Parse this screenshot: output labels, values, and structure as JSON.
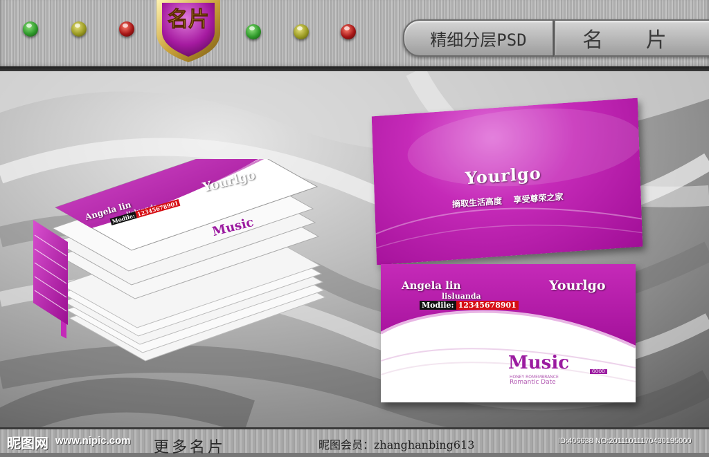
{
  "header": {
    "badge_text": "名片",
    "plaque_left": "精细分层PSD",
    "plaque_right": "名 片",
    "indicator_lights": [
      {
        "name": "green-light",
        "color": "#2e9a2a"
      },
      {
        "name": "yellow-light",
        "color": "#9a9a22"
      },
      {
        "name": "red-light",
        "color": "#a51616"
      },
      {
        "name": "green-light",
        "color": "#2e9a2a"
      },
      {
        "name": "yellow-light",
        "color": "#9a9a22"
      },
      {
        "name": "red-light",
        "color": "#a51616"
      }
    ]
  },
  "card_back": {
    "logo": "Yourlgo",
    "slogan": "摘取生活高度    享受尊荣之家"
  },
  "card_front": {
    "name": "Angela lin",
    "subname": "lisluanda",
    "mobile_label": "Modile:",
    "mobile_number": "12345678901",
    "logo": "Yourlgo",
    "music_title": "Music",
    "music_tag": "GOOD",
    "honey_line": "HONEY ROMEMBRANCE",
    "romantic_line": "Romantic Date"
  },
  "stack_card": {
    "name": "Angela lin",
    "subname": "lisluanda",
    "mobile_label": "Modile:",
    "mobile_number": "12345678901",
    "logo": "Yourlgo",
    "music_title": "Music"
  },
  "footer": {
    "site_logo": "昵图网",
    "site_url": "www.nipic.com",
    "left_text": "更多名片",
    "member_text": "昵图会员：zhanghanbing613",
    "id_text": "ID:406638 NO:20111011170430195000"
  },
  "colors": {
    "magenta": "#c42ab8",
    "magenta_dark": "#9b0f92",
    "mobile_red": "#d60e14"
  }
}
